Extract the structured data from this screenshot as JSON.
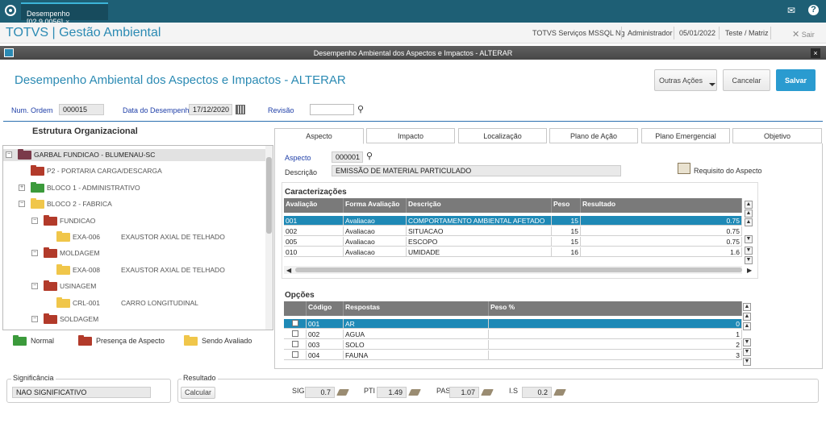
{
  "browser": {
    "tab_title": "Desempenho [02.9.0056]",
    "tab_close": "×"
  },
  "header": {
    "app_title": "TOTVS | Gestão Ambiental",
    "server": "TOTVS Serviços MSSQL Ng",
    "user": "Administrador",
    "date": "05/01/2022",
    "branch": "Teste / Matriz",
    "exit_label": "Sair"
  },
  "dialog": {
    "title": "Desempenho Ambiental dos Aspectos e Impactos - ALTERAR",
    "close": "×"
  },
  "form": {
    "title": "Desempenho Ambiental dos Aspectos e Impactos - ALTERAR",
    "outras_acoes": "Outras Ações",
    "cancelar": "Cancelar",
    "salvar": "Salvar",
    "num_ordem_label": "Num. Ordem",
    "num_ordem": "000015",
    "data_label": "Data do Desempenho",
    "data": "17/12/2020",
    "revisao_label": "Revisão",
    "revisao": ""
  },
  "tree": {
    "title": "Estrutura Organizacional",
    "items": [
      {
        "label": "GARBAL FUNDICAO - BLUMENAU-SC",
        "code": "",
        "desc": "",
        "color": "maroon",
        "expander": "−"
      },
      {
        "label": "P2 - PORTARIA CARGA/DESCARGA",
        "code": "",
        "desc": "",
        "color": "red",
        "expander": ""
      },
      {
        "label": "BLOCO 1 - ADMINISTRATIVO",
        "code": "",
        "desc": "",
        "color": "green",
        "expander": "+"
      },
      {
        "label": "BLOCO 2 - FABRICA",
        "code": "",
        "desc": "",
        "color": "yellow",
        "expander": "−"
      },
      {
        "label": "FUNDICAO",
        "code": "",
        "desc": "",
        "color": "red",
        "expander": "−"
      },
      {
        "label": "",
        "code": "EXA-006",
        "desc": "EXAUSTOR AXIAL DE TELHADO",
        "color": "yellow",
        "expander": ""
      },
      {
        "label": "MOLDAGEM",
        "code": "",
        "desc": "",
        "color": "red",
        "expander": "−"
      },
      {
        "label": "",
        "code": "EXA-008",
        "desc": "EXAUSTOR AXIAL DE TELHADO",
        "color": "yellow",
        "expander": ""
      },
      {
        "label": "USINAGEM",
        "code": "",
        "desc": "",
        "color": "red",
        "expander": "−"
      },
      {
        "label": "",
        "code": "CRL-001",
        "desc": "CARRO LONGITUDINAL",
        "color": "yellow",
        "expander": ""
      },
      {
        "label": "SOLDAGEM",
        "code": "",
        "desc": "",
        "color": "red",
        "expander": "−"
      }
    ],
    "legend": {
      "normal": "Normal",
      "presenca": "Presença de Aspecto",
      "avaliado": "Sendo Avaliado"
    }
  },
  "tabs": [
    "Aspecto",
    "Impacto",
    "Localização",
    "Plano de Ação",
    "Plano Emergencial",
    "Objetivo"
  ],
  "aspecto": {
    "aspecto_label": "Aspecto",
    "aspecto_code": "000001",
    "descricao_label": "Descrição",
    "descricao": "EMISSÃO DE MATERIAL PARTICULADO",
    "requisito_label": "Requisito do Aspecto"
  },
  "caracterizacoes": {
    "title": "Caracterizações",
    "headers": [
      "Avaliação",
      "Forma Avaliação",
      "Descrição",
      "Peso",
      "Resultado"
    ],
    "rows": [
      [
        "001",
        "Avaliacao",
        "COMPORTAMENTO AMBIENTAL AFETADO",
        "15",
        "0.75"
      ],
      [
        "002",
        "Avaliacao",
        "SITUACAO",
        "15",
        "0.75"
      ],
      [
        "005",
        "Avaliacao",
        "ESCOPO",
        "15",
        "0.75"
      ],
      [
        "010",
        "Avaliacao",
        "UMIDADE",
        "16",
        "1.6"
      ]
    ]
  },
  "opcoes": {
    "title": "Opções",
    "headers": [
      "",
      "Código",
      "Respostas",
      "Peso %"
    ],
    "rows": [
      [
        "001",
        "AR",
        "0"
      ],
      [
        "002",
        "AGUA",
        "1"
      ],
      [
        "003",
        "SOLO",
        "2"
      ],
      [
        "004",
        "FAUNA",
        "3"
      ]
    ]
  },
  "bottom": {
    "significancia_label": "Significância",
    "significancia": "NAO SIGNIFICATIVO",
    "resultado_label": "Resultado",
    "calcular": "Calcular",
    "sig_label": "SIG",
    "sig": "0.7",
    "pti_label": "PTI",
    "pti": "1.49",
    "pas_label": "PAS",
    "pas": "1.07",
    "is_label": "I.S",
    "is": "0.2"
  },
  "colors": {
    "accent": "#2b8ab3",
    "topbar": "#1e5f75",
    "selected_row": "#1e89b6",
    "save": "#2a9bd0"
  }
}
